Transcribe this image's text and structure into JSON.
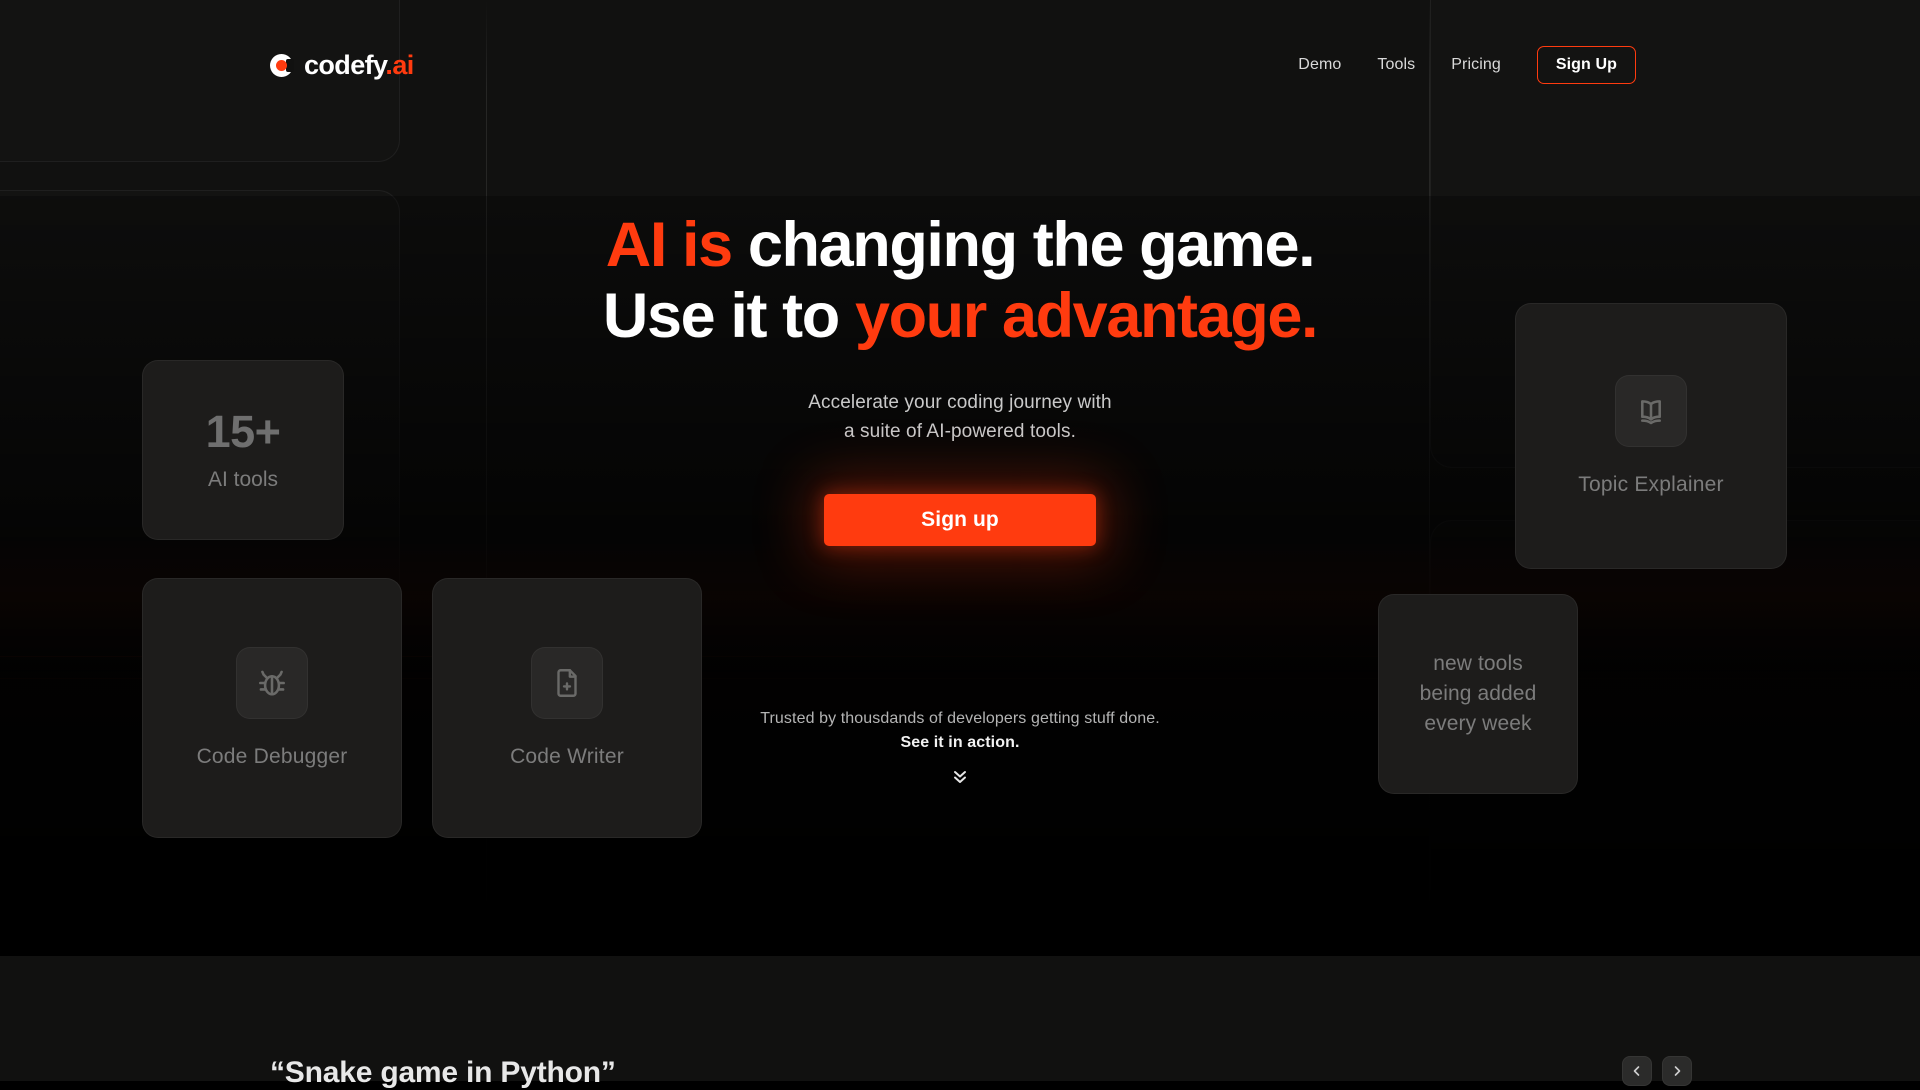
{
  "brand": {
    "name_main": "codefy",
    "name_dot": ".",
    "name_accent": "ai",
    "accent_color": "#FF3B0F",
    "mark_icon": "codefy-circle-logo-icon"
  },
  "header": {
    "nav": [
      {
        "label": "Demo"
      },
      {
        "label": "Tools"
      },
      {
        "label": "Pricing"
      }
    ],
    "signup_label": "Sign Up"
  },
  "hero": {
    "headline_line1_accent": "AI is",
    "headline_line1_rest": " changing the game.",
    "headline_line2_plain": "Use it to ",
    "headline_line2_accent": "your advantage.",
    "subtitle_line1": "Accelerate your coding journey with",
    "subtitle_line2": "a suite of AI-powered tools.",
    "cta_label": "Sign up",
    "trust_line": "Trusted by thousdands of developers getting stuff done.",
    "trust_cta": "See it in action.",
    "scroll_icon": "double-chevron-down-icon"
  },
  "cards": {
    "stat": {
      "number": "15+",
      "label": "AI tools"
    },
    "debugger": {
      "label": "Code Debugger",
      "icon": "bug-icon"
    },
    "writer": {
      "label": "Code Writer",
      "icon": "file-plus-icon"
    },
    "topic": {
      "label": "Topic Explainer",
      "icon": "open-book-icon"
    },
    "newtools": {
      "line1": "new tools",
      "line2": "being added",
      "line3": "every week"
    }
  },
  "bottom": {
    "title": "“Snake game in Python”",
    "prev_icon": "chevron-left-icon",
    "next_icon": "chevron-right-icon"
  }
}
